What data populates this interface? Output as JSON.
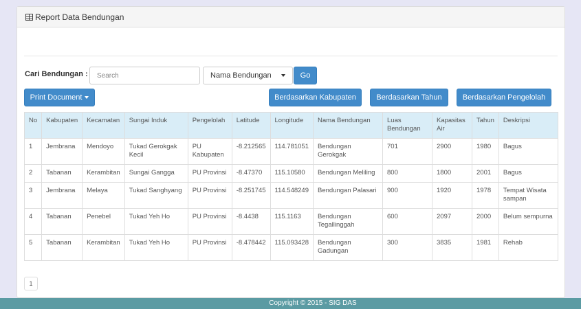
{
  "panel": {
    "title": "Report Data Bendungan"
  },
  "search": {
    "label": "Cari Bendungan :",
    "placeholder": "Search",
    "select_value": "Nama Bendungan",
    "go_label": "Go"
  },
  "toolbar": {
    "print_label": "Print Document",
    "kabupaten_label": "Berdasarkan Kabupaten",
    "tahun_label": "Berdasarkan Tahun",
    "pengelolah_label": "Berdasarkan Pengelolah"
  },
  "table": {
    "headers": [
      "No",
      "Kabupaten",
      "Kecamatan",
      "Sungai Induk",
      "Pengelolah",
      "Latitude",
      "Longitude",
      "Nama Bendungan",
      "Luas Bendungan",
      "Kapasitas Air",
      "Tahun",
      "Deskripsi"
    ],
    "rows": [
      [
        "1",
        "Jembrana",
        "Mendoyo",
        "Tukad Gerokgak Kecil",
        "PU Kabupaten",
        "-8.212565",
        "114.781051",
        "Bendungan Gerokgak",
        "701",
        "2900",
        "1980",
        "Bagus"
      ],
      [
        "2",
        "Tabanan",
        "Kerambitan",
        "Sungai Gangga",
        "PU Provinsi",
        "-8.47370",
        "115.10580",
        "Bendungan Meliling",
        "800",
        "1800",
        "2001",
        "Bagus"
      ],
      [
        "3",
        "Jembrana",
        "Melaya",
        "Tukad Sanghyang",
        "PU Provinsi",
        "-8.251745",
        "114.548249",
        "Bendungan Palasari",
        "900",
        "1920",
        "1978",
        "Tempat Wisata sampan"
      ],
      [
        "4",
        "Tabanan",
        "Penebel",
        "Tukad Yeh Ho",
        "PU Provinsi",
        "-8.4438",
        "115.1163",
        "Bendungan Tegallinggah",
        "600",
        "2097",
        "2000",
        "Belum sempurna"
      ],
      [
        "5",
        "Tabanan",
        "Kerambitan",
        "Tukad Yeh Ho",
        "PU Provinsi",
        "-8.478442",
        "115.093428",
        "Bendungan Gadungan",
        "300",
        "3835",
        "1981",
        "Rehab"
      ]
    ]
  },
  "pagination": {
    "current_page": "1"
  },
  "footer": {
    "text": "Copyright © 2015 - SIG DAS"
  }
}
